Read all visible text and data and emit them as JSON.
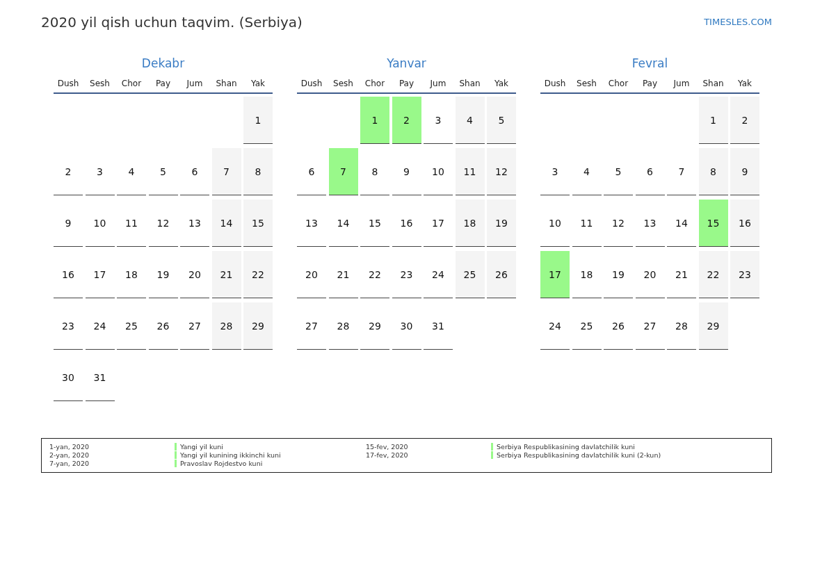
{
  "title": "2020 yil qish uchun taqvim. (Serbiya)",
  "site_link": "TIMESLES.COM",
  "months": [
    {
      "name": "Dekabr",
      "weekdays": [
        "Dush",
        "Sesh",
        "Chor",
        "Pay",
        "Jum",
        "Shan",
        "Yak"
      ],
      "weeks": [
        [
          {
            "kind": "blank"
          },
          {
            "kind": "blank"
          },
          {
            "kind": "blank"
          },
          {
            "kind": "blank"
          },
          {
            "kind": "blank"
          },
          {
            "kind": "blank"
          },
          {
            "day": "1",
            "kind": "weekend"
          }
        ],
        [
          {
            "day": "2",
            "kind": "weekday"
          },
          {
            "day": "3",
            "kind": "weekday"
          },
          {
            "day": "4",
            "kind": "weekday"
          },
          {
            "day": "5",
            "kind": "weekday"
          },
          {
            "day": "6",
            "kind": "weekday"
          },
          {
            "day": "7",
            "kind": "weekend"
          },
          {
            "day": "8",
            "kind": "weekend"
          }
        ],
        [
          {
            "day": "9",
            "kind": "weekday"
          },
          {
            "day": "10",
            "kind": "weekday"
          },
          {
            "day": "11",
            "kind": "weekday"
          },
          {
            "day": "12",
            "kind": "weekday"
          },
          {
            "day": "13",
            "kind": "weekday"
          },
          {
            "day": "14",
            "kind": "weekend"
          },
          {
            "day": "15",
            "kind": "weekend"
          }
        ],
        [
          {
            "day": "16",
            "kind": "weekday"
          },
          {
            "day": "17",
            "kind": "weekday"
          },
          {
            "day": "18",
            "kind": "weekday"
          },
          {
            "day": "19",
            "kind": "weekday"
          },
          {
            "day": "20",
            "kind": "weekday"
          },
          {
            "day": "21",
            "kind": "weekend"
          },
          {
            "day": "22",
            "kind": "weekend"
          }
        ],
        [
          {
            "day": "23",
            "kind": "weekday"
          },
          {
            "day": "24",
            "kind": "weekday"
          },
          {
            "day": "25",
            "kind": "weekday"
          },
          {
            "day": "26",
            "kind": "weekday"
          },
          {
            "day": "27",
            "kind": "weekday"
          },
          {
            "day": "28",
            "kind": "weekend"
          },
          {
            "day": "29",
            "kind": "weekend"
          }
        ],
        [
          {
            "day": "30",
            "kind": "weekday"
          },
          {
            "day": "31",
            "kind": "weekday"
          }
        ]
      ]
    },
    {
      "name": "Yanvar",
      "weekdays": [
        "Dush",
        "Sesh",
        "Chor",
        "Pay",
        "Jum",
        "Shan",
        "Yak"
      ],
      "weeks": [
        [
          {
            "kind": "blank"
          },
          {
            "kind": "blank"
          },
          {
            "day": "1",
            "kind": "holiday"
          },
          {
            "day": "2",
            "kind": "holiday"
          },
          {
            "day": "3",
            "kind": "weekday"
          },
          {
            "day": "4",
            "kind": "weekend"
          },
          {
            "day": "5",
            "kind": "weekend"
          }
        ],
        [
          {
            "day": "6",
            "kind": "weekday"
          },
          {
            "day": "7",
            "kind": "holiday"
          },
          {
            "day": "8",
            "kind": "weekday"
          },
          {
            "day": "9",
            "kind": "weekday"
          },
          {
            "day": "10",
            "kind": "weekday"
          },
          {
            "day": "11",
            "kind": "weekend"
          },
          {
            "day": "12",
            "kind": "weekend"
          }
        ],
        [
          {
            "day": "13",
            "kind": "weekday"
          },
          {
            "day": "14",
            "kind": "weekday"
          },
          {
            "day": "15",
            "kind": "weekday"
          },
          {
            "day": "16",
            "kind": "weekday"
          },
          {
            "day": "17",
            "kind": "weekday"
          },
          {
            "day": "18",
            "kind": "weekend"
          },
          {
            "day": "19",
            "kind": "weekend"
          }
        ],
        [
          {
            "day": "20",
            "kind": "weekday"
          },
          {
            "day": "21",
            "kind": "weekday"
          },
          {
            "day": "22",
            "kind": "weekday"
          },
          {
            "day": "23",
            "kind": "weekday"
          },
          {
            "day": "24",
            "kind": "weekday"
          },
          {
            "day": "25",
            "kind": "weekend"
          },
          {
            "day": "26",
            "kind": "weekend"
          }
        ],
        [
          {
            "day": "27",
            "kind": "weekday"
          },
          {
            "day": "28",
            "kind": "weekday"
          },
          {
            "day": "29",
            "kind": "weekday"
          },
          {
            "day": "30",
            "kind": "weekday"
          },
          {
            "day": "31",
            "kind": "weekday"
          }
        ]
      ]
    },
    {
      "name": "Fevral",
      "weekdays": [
        "Dush",
        "Sesh",
        "Chor",
        "Pay",
        "Jum",
        "Shan",
        "Yak"
      ],
      "weeks": [
        [
          {
            "kind": "blank"
          },
          {
            "kind": "blank"
          },
          {
            "kind": "blank"
          },
          {
            "kind": "blank"
          },
          {
            "kind": "blank"
          },
          {
            "day": "1",
            "kind": "weekend"
          },
          {
            "day": "2",
            "kind": "weekend"
          }
        ],
        [
          {
            "day": "3",
            "kind": "weekday"
          },
          {
            "day": "4",
            "kind": "weekday"
          },
          {
            "day": "5",
            "kind": "weekday"
          },
          {
            "day": "6",
            "kind": "weekday"
          },
          {
            "day": "7",
            "kind": "weekday"
          },
          {
            "day": "8",
            "kind": "weekend"
          },
          {
            "day": "9",
            "kind": "weekend"
          }
        ],
        [
          {
            "day": "10",
            "kind": "weekday"
          },
          {
            "day": "11",
            "kind": "weekday"
          },
          {
            "day": "12",
            "kind": "weekday"
          },
          {
            "day": "13",
            "kind": "weekday"
          },
          {
            "day": "14",
            "kind": "weekday"
          },
          {
            "day": "15",
            "kind": "holiday"
          },
          {
            "day": "16",
            "kind": "weekend"
          }
        ],
        [
          {
            "day": "17",
            "kind": "holiday"
          },
          {
            "day": "18",
            "kind": "weekday"
          },
          {
            "day": "19",
            "kind": "weekday"
          },
          {
            "day": "20",
            "kind": "weekday"
          },
          {
            "day": "21",
            "kind": "weekday"
          },
          {
            "day": "22",
            "kind": "weekend"
          },
          {
            "day": "23",
            "kind": "weekend"
          }
        ],
        [
          {
            "day": "24",
            "kind": "weekday"
          },
          {
            "day": "25",
            "kind": "weekday"
          },
          {
            "day": "26",
            "kind": "weekday"
          },
          {
            "day": "27",
            "kind": "weekday"
          },
          {
            "day": "28",
            "kind": "weekday"
          },
          {
            "day": "29",
            "kind": "weekend"
          }
        ]
      ]
    }
  ],
  "legend": [
    [
      {
        "date": "1-yan, 2020",
        "name": "Yangi yil kuni"
      },
      {
        "date": "2-yan, 2020",
        "name": "Yangi yil kunining ikkinchi kuni"
      },
      {
        "date": "7-yan, 2020",
        "name": "Pravoslav Rojdestvo kuni"
      }
    ],
    [
      {
        "date": "15-fev, 2020",
        "name": "Serbiya Respublikasining davlatchilik kuni"
      },
      {
        "date": "17-fev, 2020",
        "name": "Serbiya Respublikasining davlatchilik kuni (2-kun)"
      }
    ]
  ]
}
